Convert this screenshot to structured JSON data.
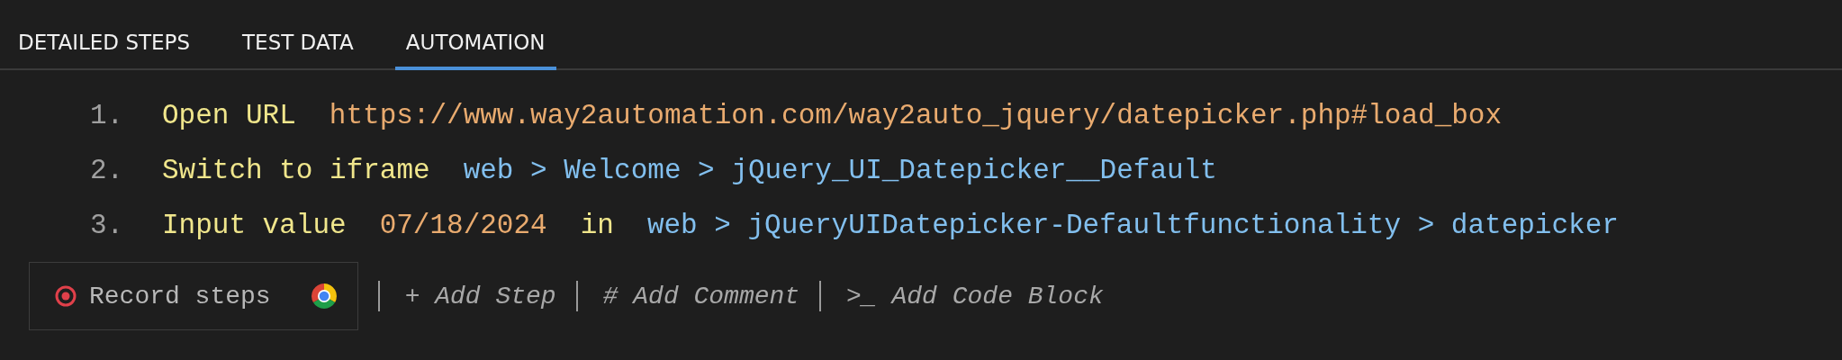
{
  "tabs": [
    {
      "label": "DETAILED STEPS",
      "selected": false
    },
    {
      "label": "TEST DATA",
      "selected": false
    },
    {
      "label": "AUTOMATION",
      "selected": true
    }
  ],
  "steps": [
    {
      "number": "1.",
      "parts": [
        {
          "kind": "keyword",
          "text": "Open URL"
        },
        {
          "kind": "value",
          "text": "https://www.way2automation.com/way2auto_jquery/datepicker.php#load_box"
        }
      ]
    },
    {
      "number": "2.",
      "parts": [
        {
          "kind": "keyword",
          "text": "Switch to iframe"
        },
        {
          "kind": "target",
          "text": "web > Welcome > jQuery_UI_Datepicker__Default"
        }
      ]
    },
    {
      "number": "3.",
      "parts": [
        {
          "kind": "keyword",
          "text": "Input value"
        },
        {
          "kind": "value",
          "text": "07/18/2024"
        },
        {
          "kind": "keyword",
          "text": "in"
        },
        {
          "kind": "target",
          "text": "web > jQueryUIDatepicker-Defaultfunctionality > datepicker"
        }
      ]
    }
  ],
  "record_button": {
    "label": "Record steps"
  },
  "actions": [
    "+ Add Step",
    "# Add Comment",
    ">_ Add Code Block"
  ]
}
